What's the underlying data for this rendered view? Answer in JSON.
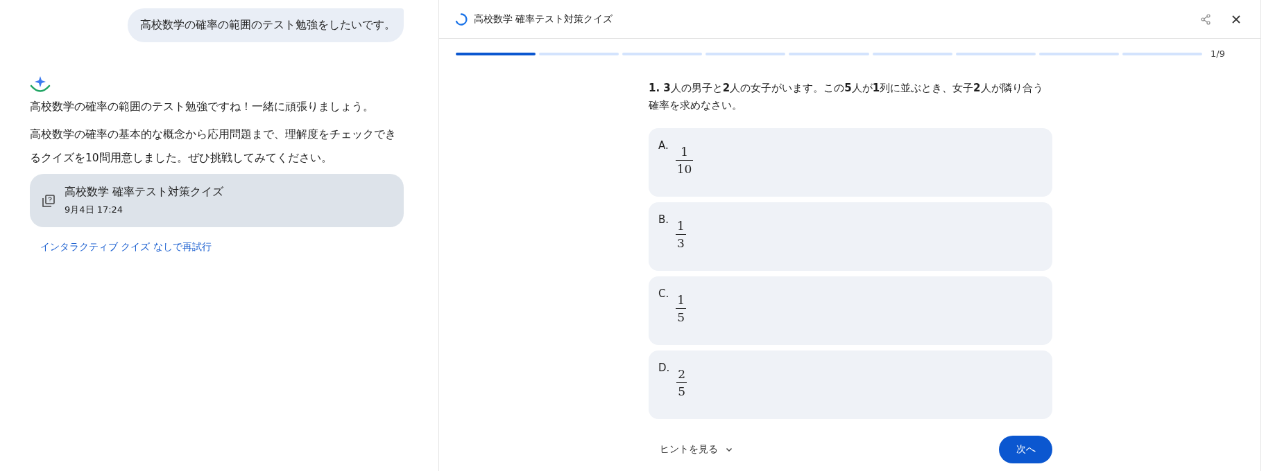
{
  "chat": {
    "user_message": "高校数学の確率の範囲のテスト勉強をしたいです。",
    "reply_paragraphs": [
      "高校数学の確率の範囲のテスト勉強ですね！一緒に頑張りましょう。",
      "高校数学の確率の基本的な概念から応用問題まで、理解度をチェックできるクイズを10問用意しました。ぜひ挑戦してみてください。"
    ],
    "quiz_card": {
      "title": "高校数学 確率テスト対策クイズ",
      "date": "9月4日 17:24"
    },
    "retry_link": "インタラクティブ クイズ なしで再試行"
  },
  "quiz_panel": {
    "title": "高校数学 確率テスト対策クイズ",
    "progress": {
      "segments": [
        {
          "done": true
        },
        {
          "done": false
        },
        {
          "done": false
        },
        {
          "done": false
        },
        {
          "done": false
        },
        {
          "done": false
        },
        {
          "done": false
        },
        {
          "done": false
        },
        {
          "done": false
        }
      ],
      "counter": "1/9"
    },
    "question": "**1. 3**人の男子と**2**人の女子がいます。この**5**人が**1**列に並ぶとき、女子**2**人が隣り合う確率を求めなさい。",
    "options": [
      {
        "label": "A.",
        "numerator": "1",
        "denominator": "10"
      },
      {
        "label": "B.",
        "numerator": "1",
        "denominator": "3"
      },
      {
        "label": "C.",
        "numerator": "1",
        "denominator": "5"
      },
      {
        "label": "D.",
        "numerator": "2",
        "denominator": "5"
      }
    ],
    "hint_button": "ヒントを見る",
    "next_button": "次へ"
  }
}
